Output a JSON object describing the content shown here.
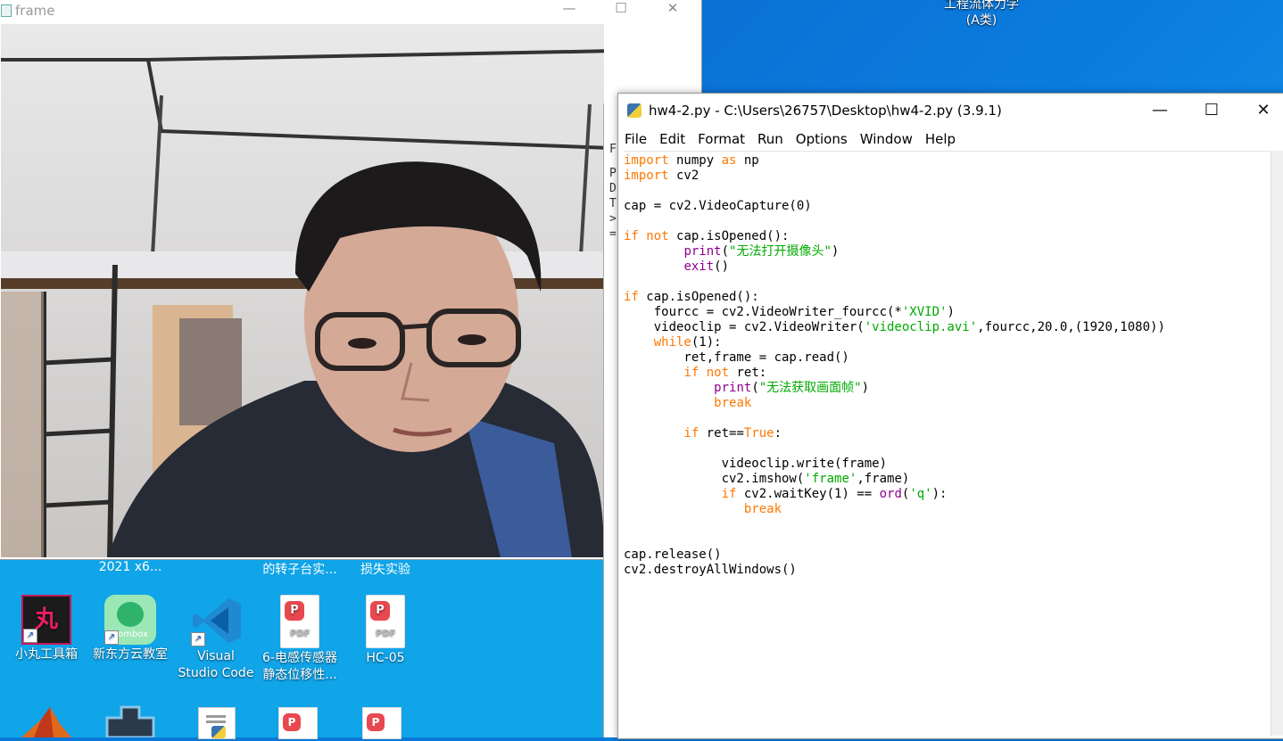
{
  "desktop": {
    "top_label_line1": "工程流体力学",
    "top_label_line2": "(A类)",
    "partial_labels": [
      "2021 x6...",
      "的转子台实...",
      "损失实验"
    ],
    "icons": [
      {
        "line1": "小丸工具箱",
        "line2": "",
        "glyph": "丸"
      },
      {
        "line1": "新东方云教室",
        "line2": "",
        "glyph": "oombox"
      },
      {
        "line1": "Visual",
        "line2": "Studio Code",
        "glyph": "vscode-icon"
      },
      {
        "line1": "6-电感传感器",
        "line2": "静态位移性...",
        "glyph": "pdf-icon"
      },
      {
        "line1": "HC-05",
        "line2": "",
        "glyph": "pdf-icon"
      }
    ]
  },
  "frame_window": {
    "title": "frame",
    "controls": [
      "—",
      "☐",
      "✕"
    ]
  },
  "shell_sliver": [
    "F",
    "P",
    "D",
    "T",
    ">",
    "="
  ],
  "idle": {
    "title": "hw4-2.py - C:\\Users\\26757\\Desktop\\hw4-2.py (3.9.1)",
    "controls": [
      "—",
      "☐",
      "✕"
    ],
    "menu": [
      "File",
      "Edit",
      "Format",
      "Run",
      "Options",
      "Window",
      "Help"
    ],
    "code_lines": [
      [
        {
          "t": "import",
          "c": "kw"
        },
        {
          "t": " numpy ",
          "c": ""
        },
        {
          "t": "as",
          "c": "kw"
        },
        {
          "t": " np",
          "c": ""
        }
      ],
      [
        {
          "t": "import",
          "c": "kw"
        },
        {
          "t": " cv2",
          "c": ""
        }
      ],
      [],
      [
        {
          "t": "cap = cv2.VideoCapture(0)",
          "c": ""
        }
      ],
      [],
      [
        {
          "t": "if",
          "c": "kw"
        },
        {
          "t": " ",
          "c": ""
        },
        {
          "t": "not",
          "c": "kw"
        },
        {
          "t": " cap.isOpened():",
          "c": ""
        }
      ],
      [
        {
          "t": "        ",
          "c": ""
        },
        {
          "t": "print",
          "c": "bi"
        },
        {
          "t": "(",
          "c": ""
        },
        {
          "t": "\"无法打开摄像头\"",
          "c": "str"
        },
        {
          "t": ")",
          "c": ""
        }
      ],
      [
        {
          "t": "        ",
          "c": ""
        },
        {
          "t": "exit",
          "c": "bi"
        },
        {
          "t": "()",
          "c": ""
        }
      ],
      [],
      [
        {
          "t": "if",
          "c": "kw"
        },
        {
          "t": " cap.isOpened():",
          "c": ""
        }
      ],
      [
        {
          "t": "    fourcc = cv2.VideoWriter_fourcc(*",
          "c": ""
        },
        {
          "t": "'XVID'",
          "c": "str"
        },
        {
          "t": ")",
          "c": ""
        }
      ],
      [
        {
          "t": "    videoclip = cv2.VideoWriter(",
          "c": ""
        },
        {
          "t": "'videoclip.avi'",
          "c": "str"
        },
        {
          "t": ",fourcc,20.0,(1920,1080))",
          "c": ""
        }
      ],
      [
        {
          "t": "    ",
          "c": ""
        },
        {
          "t": "while",
          "c": "kw"
        },
        {
          "t": "(1):",
          "c": ""
        }
      ],
      [
        {
          "t": "        ret,frame = cap.read()",
          "c": ""
        }
      ],
      [
        {
          "t": "        ",
          "c": ""
        },
        {
          "t": "if",
          "c": "kw"
        },
        {
          "t": " ",
          "c": ""
        },
        {
          "t": "not",
          "c": "kw"
        },
        {
          "t": " ret:",
          "c": ""
        }
      ],
      [
        {
          "t": "            ",
          "c": ""
        },
        {
          "t": "print",
          "c": "bi"
        },
        {
          "t": "(",
          "c": ""
        },
        {
          "t": "\"无法获取画面帧\"",
          "c": "str"
        },
        {
          "t": ")",
          "c": ""
        }
      ],
      [
        {
          "t": "            ",
          "c": ""
        },
        {
          "t": "break",
          "c": "kw"
        }
      ],
      [],
      [
        {
          "t": "        ",
          "c": ""
        },
        {
          "t": "if",
          "c": "kw"
        },
        {
          "t": " ret==",
          "c": ""
        },
        {
          "t": "True",
          "c": "kw"
        },
        {
          "t": ":",
          "c": ""
        }
      ],
      [],
      [
        {
          "t": "             videoclip.write(frame)",
          "c": ""
        }
      ],
      [
        {
          "t": "             cv2.imshow(",
          "c": ""
        },
        {
          "t": "'frame'",
          "c": "str"
        },
        {
          "t": ",frame)",
          "c": ""
        }
      ],
      [
        {
          "t": "             ",
          "c": ""
        },
        {
          "t": "if",
          "c": "kw"
        },
        {
          "t": " cv2.waitKey(1) == ",
          "c": ""
        },
        {
          "t": "ord",
          "c": "bi"
        },
        {
          "t": "(",
          "c": ""
        },
        {
          "t": "'q'",
          "c": "str"
        },
        {
          "t": "):",
          "c": ""
        }
      ],
      [
        {
          "t": "                ",
          "c": ""
        },
        {
          "t": "break",
          "c": "kw"
        }
      ],
      [],
      [],
      [
        {
          "t": "cap.release()",
          "c": ""
        }
      ],
      [
        {
          "t": "cv2.destroyAllWindows()",
          "c": ""
        }
      ]
    ]
  }
}
